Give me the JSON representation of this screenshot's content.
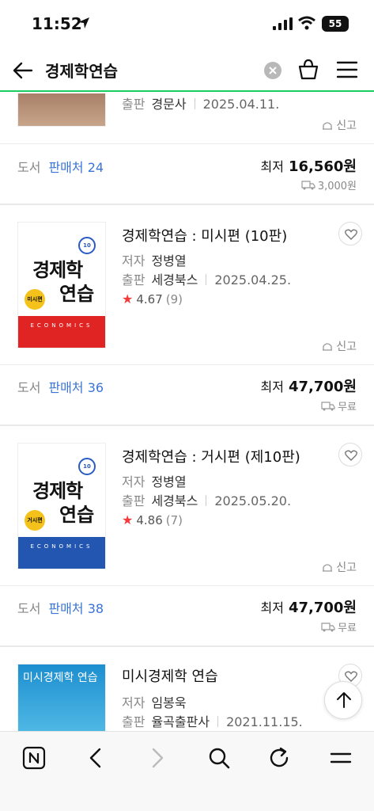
{
  "status_bar": {
    "time": "11:52",
    "battery": "55"
  },
  "header": {
    "search_query": "경제학연습"
  },
  "top_item": {
    "publisher_label": "출판",
    "publisher": "경문사",
    "date": "2025.04.11.",
    "report": "신고",
    "category": "도서",
    "sellers": "판매처 24",
    "price_label": "최저",
    "price": "16,560원",
    "shipping": "3,000원"
  },
  "products": [
    {
      "title": "경제학연습 : 미시편 (10판)",
      "author_label": "저자",
      "author": "정병열",
      "publisher_label": "출판",
      "publisher": "세경북스",
      "date": "2025.04.25.",
      "rating": "4.67",
      "review_count": "(9)",
      "report": "신고",
      "category": "도서",
      "sellers": "판매처 36",
      "price_label": "최저",
      "price": "47,700원",
      "shipping": "무료",
      "cover": {
        "line1": "경제학",
        "line2": "연습",
        "badge": "미시편",
        "band_text": "ECONOMICS",
        "color": "#e02424"
      }
    },
    {
      "title": "경제학연습 : 거시편 (제10판)",
      "author_label": "저자",
      "author": "정병열",
      "publisher_label": "출판",
      "publisher": "세경북스",
      "date": "2025.05.20.",
      "rating": "4.86",
      "review_count": "(7)",
      "report": "신고",
      "category": "도서",
      "sellers": "판매처 38",
      "price_label": "최저",
      "price": "47,700원",
      "shipping": "무료",
      "cover": {
        "line1": "경제학",
        "line2": "연습",
        "badge": "거시편",
        "band_text": "ECONOMICS",
        "color": "#2356b0"
      }
    },
    {
      "title": "미시경제학 연습",
      "author_label": "저자",
      "author": "임봉욱",
      "publisher_label": "출판",
      "publisher": "율곡출판사",
      "date": "2021.11.15.",
      "cover": {
        "line1": "미시경제학 연습"
      }
    }
  ],
  "colors": {
    "accent": "#19ce60",
    "link": "#3a74d6",
    "star": "#f23b3b"
  },
  "icons": [
    "back-arrow-icon",
    "clear-icon",
    "cart-icon",
    "menu-icon",
    "heart-icon",
    "report-icon",
    "truck-icon",
    "arrow-up-icon",
    "naver-n-icon",
    "chevron-left-icon",
    "chevron-right-icon",
    "search-icon",
    "refresh-icon",
    "menu-icon"
  ]
}
